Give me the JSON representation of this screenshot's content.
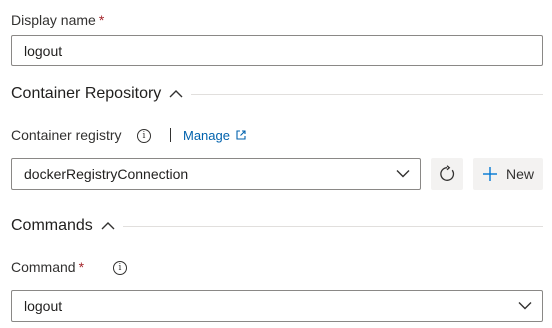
{
  "display_name": {
    "label": "Display name",
    "required_mark": "*",
    "value": "logout"
  },
  "container_repository": {
    "title": "Container Repository",
    "expanded": true,
    "registry_label": "Container registry",
    "info_icon": "info-icon",
    "manage_link": "Manage",
    "manage_icon": "external-link-icon",
    "registry_value": "dockerRegistryConnection",
    "refresh_icon": "refresh-icon",
    "new_button": "New",
    "new_icon": "plus-icon"
  },
  "commands": {
    "title": "Commands",
    "expanded": true,
    "command_label": "Command",
    "required_mark": "*",
    "info_icon": "info-icon",
    "command_value": "logout"
  },
  "colors": {
    "required": "#a4262c",
    "link": "#0062ad",
    "plus_icon": "#0078d4",
    "border": "#8a8886",
    "button_bg": "#f3f2f1"
  }
}
